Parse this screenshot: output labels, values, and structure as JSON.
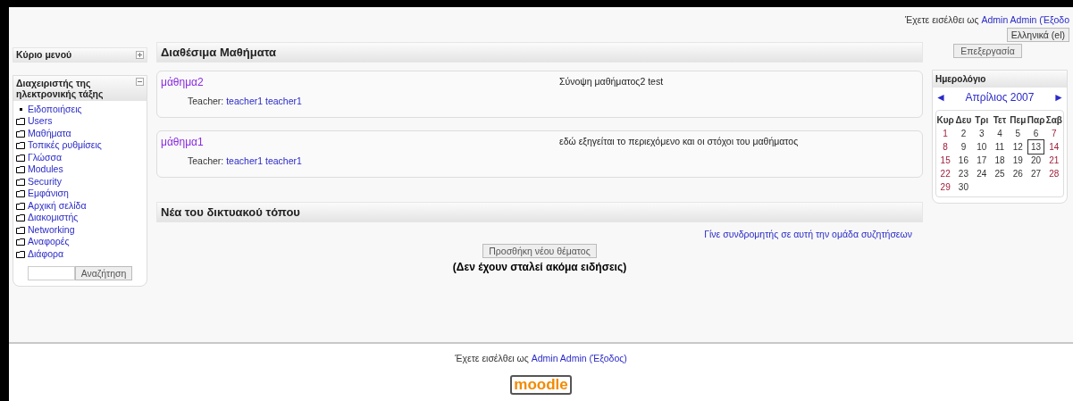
{
  "header": {
    "login_prefix": "Έχετε εισέλθει ως",
    "login_user": "Admin Admin",
    "login_logout": "(Έξοδο",
    "language": "Ελληνικά (el)"
  },
  "main_menu": {
    "title": "Κύριο μενού",
    "expanded": false
  },
  "admin_block": {
    "title": "Διαχειριστής της ηλεκτρονικής τάξης",
    "expanded": true,
    "items": [
      {
        "label": "Ειδοποιήσεις",
        "kind": "bullet"
      },
      {
        "label": "Users",
        "kind": "folder"
      },
      {
        "label": "Μαθήματα",
        "kind": "folder"
      },
      {
        "label": "Τοπικές ρυθμίσεις",
        "kind": "folder"
      },
      {
        "label": "Γλώσσα",
        "kind": "folder"
      },
      {
        "label": "Modules",
        "kind": "folder"
      },
      {
        "label": "Security",
        "kind": "folder"
      },
      {
        "label": "Εμφάνιση",
        "kind": "folder"
      },
      {
        "label": "Αρχική σελίδα",
        "kind": "folder"
      },
      {
        "label": "Διακομιστής",
        "kind": "folder"
      },
      {
        "label": "Networking",
        "kind": "folder"
      },
      {
        "label": "Αναφορές",
        "kind": "folder"
      },
      {
        "label": "Διάφορα",
        "kind": "folder"
      }
    ],
    "search_button": "Αναζήτηση"
  },
  "courses": {
    "title": "Διαθέσιμα Μαθήματα",
    "items": [
      {
        "name": "μάθημα2",
        "teacher_label": "Teacher:",
        "teacher": "teacher1 teacher1",
        "summary": "Σύνοψη μαθήματος2 test"
      },
      {
        "name": "μάθημα1",
        "teacher_label": "Teacher:",
        "teacher": "teacher1 teacher1",
        "summary": "εδώ εξηγείται το περιεχόμενο και οι στόχοι του μαθήματος"
      }
    ]
  },
  "news": {
    "title": "Νέα του δικτυακού τόπου",
    "subscribe_link": "Γίνε συνδρομητής σε αυτή την ομάδα συζητήσεων",
    "add_button": "Προσθήκη νέου θέματος",
    "empty_message": "(Δεν έχουν σταλεί ακόμα ειδήσεις)"
  },
  "edit_button": "Επεξεργασία",
  "calendar": {
    "title": "Ημερολόγιο",
    "prev": "◄",
    "month": "Απρίλιος 2007",
    "next": "►",
    "weekdays": [
      "Κυρ",
      "Δευ",
      "Τρι",
      "Τετ",
      "Πεμ",
      "Παρ",
      "Σαβ"
    ],
    "weeks": [
      [
        {
          "day": "1",
          "weekend": true,
          "today": false
        },
        {
          "day": "2",
          "weekend": false,
          "today": false
        },
        {
          "day": "3",
          "weekend": false,
          "today": false
        },
        {
          "day": "4",
          "weekend": false,
          "today": false
        },
        {
          "day": "5",
          "weekend": false,
          "today": false
        },
        {
          "day": "6",
          "weekend": false,
          "today": false
        },
        {
          "day": "7",
          "weekend": true,
          "today": false
        }
      ],
      [
        {
          "day": "8",
          "weekend": true,
          "today": false
        },
        {
          "day": "9",
          "weekend": false,
          "today": false
        },
        {
          "day": "10",
          "weekend": false,
          "today": false
        },
        {
          "day": "11",
          "weekend": false,
          "today": false
        },
        {
          "day": "12",
          "weekend": false,
          "today": false
        },
        {
          "day": "13",
          "weekend": false,
          "today": true
        },
        {
          "day": "14",
          "weekend": true,
          "today": false
        }
      ],
      [
        {
          "day": "15",
          "weekend": true,
          "today": false
        },
        {
          "day": "16",
          "weekend": false,
          "today": false
        },
        {
          "day": "17",
          "weekend": false,
          "today": false
        },
        {
          "day": "18",
          "weekend": false,
          "today": false
        },
        {
          "day": "19",
          "weekend": false,
          "today": false
        },
        {
          "day": "20",
          "weekend": false,
          "today": false
        },
        {
          "day": "21",
          "weekend": true,
          "today": false
        }
      ],
      [
        {
          "day": "22",
          "weekend": true,
          "today": false
        },
        {
          "day": "23",
          "weekend": false,
          "today": false
        },
        {
          "day": "24",
          "weekend": false,
          "today": false
        },
        {
          "day": "25",
          "weekend": false,
          "today": false
        },
        {
          "day": "26",
          "weekend": false,
          "today": false
        },
        {
          "day": "27",
          "weekend": false,
          "today": false
        },
        {
          "day": "28",
          "weekend": true,
          "today": false
        }
      ],
      [
        {
          "day": "29",
          "weekend": true,
          "today": false
        },
        {
          "day": "30",
          "weekend": false,
          "today": false
        }
      ]
    ]
  },
  "footer": {
    "login_prefix": "Έχετε εισέλθει ως",
    "login_user": "Admin Admin",
    "login_logout": "(Έξοδος)",
    "logo": "moodle"
  }
}
